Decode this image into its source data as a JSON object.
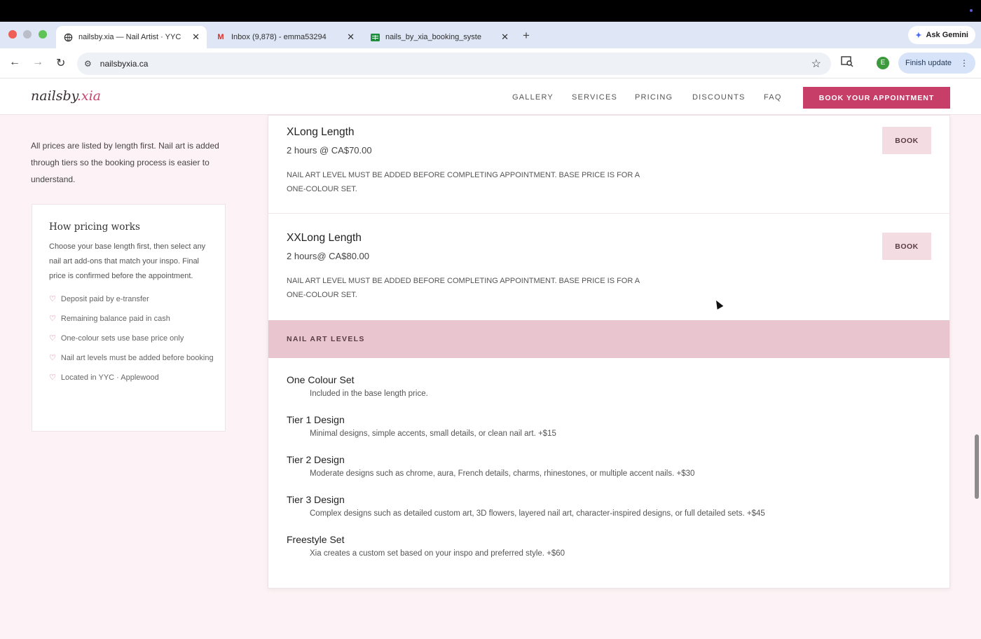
{
  "browser": {
    "tabs": [
      {
        "title": "nailsby.xia — Nail Artist · YYC",
        "icon": "globe-icon"
      },
      {
        "title": "Inbox (9,878) - emma53294",
        "icon": "gmail-icon",
        "icon_color": "#d93025"
      },
      {
        "title": "nails_by_xia_booking_syste",
        "icon": "sheets-icon",
        "icon_color": "#1e8e3e"
      }
    ],
    "new_tab": "+",
    "ask_gemini": "Ask Gemini",
    "url": "nailsbyxia.ca",
    "profile_initial": "E",
    "finish_update": "Finish update"
  },
  "site": {
    "logo_main": "nailsby",
    "logo_accent": ".xia",
    "nav": [
      "GALLERY",
      "SERVICES",
      "PRICING",
      "DISCOUNTS",
      "FAQ"
    ],
    "cta": "BOOK YOUR APPOINTMENT",
    "accent_color": "#c73e68"
  },
  "sidebar": {
    "intro": "All prices are listed by length first. Nail art is added through tiers so the booking process is easier to understand.",
    "card_title": "How pricing works",
    "card_text": "Choose your base length first, then select any nail art add-ons that match your inspo. Final price is confirmed before the appointment.",
    "bullets": [
      "Deposit paid by e-transfer",
      "Remaining balance paid in cash",
      "One-colour sets use base price only",
      "Nail art levels must be added before booking",
      "Located in YYC · Applewood"
    ]
  },
  "services": [
    {
      "name": "XLong Length",
      "time": "2 hours @ CA$70.00",
      "note": "NAIL ART LEVEL MUST BE ADDED BEFORE COMPLETING APPOINTMENT. BASE PRICE IS FOR A ONE-COLOUR SET.",
      "button": "BOOK"
    },
    {
      "name": "XXLong Length",
      "time": "2 hours@ CA$80.00",
      "note": "NAIL ART LEVEL MUST BE ADDED BEFORE COMPLETING APPOINTMENT. BASE PRICE IS FOR A ONE-COLOUR SET.",
      "button": "BOOK"
    }
  ],
  "nail_art": {
    "heading": "NAIL ART LEVELS",
    "levels": [
      {
        "name": "One Colour Set",
        "desc": "Included in the base length price."
      },
      {
        "name": "Tier 1 Design",
        "desc": "Minimal designs, simple accents, small details, or clean nail art. +$15"
      },
      {
        "name": "Tier 2 Design",
        "desc": "Moderate designs such as chrome, aura, French details, charms, rhinestones, or multiple accent nails. +$30"
      },
      {
        "name": "Tier 3 Design",
        "desc": "Complex designs such as detailed custom art, 3D flowers, layered nail art, character-inspired designs, or full detailed sets. +$45"
      },
      {
        "name": "Freestyle Set",
        "desc": "Xia creates a custom set based on your inspo and preferred style. +$60"
      }
    ]
  }
}
